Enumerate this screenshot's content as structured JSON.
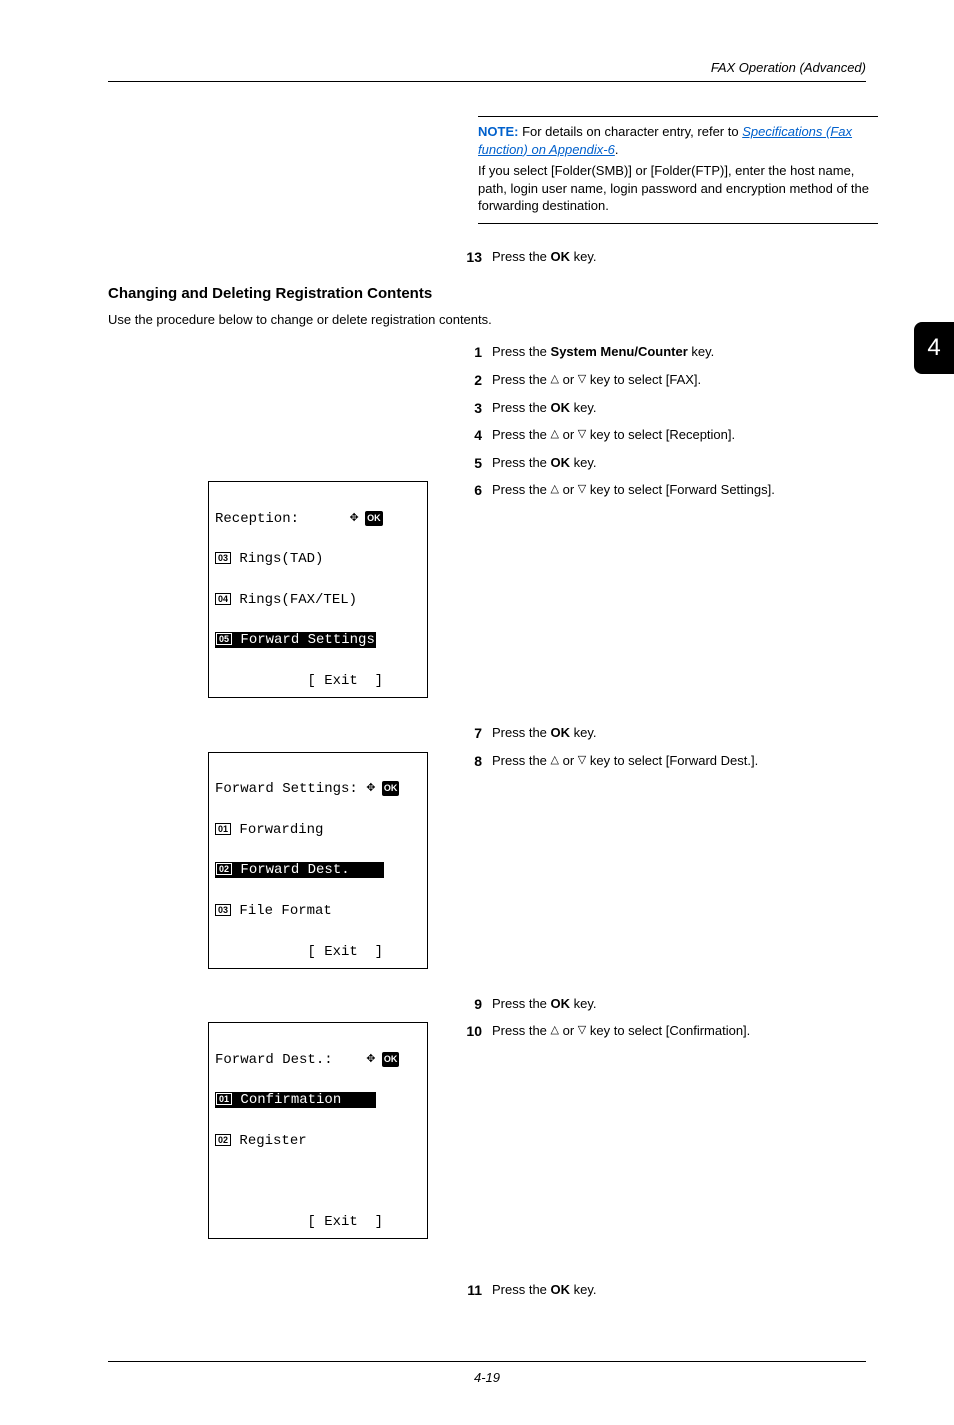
{
  "header": {
    "running": "FAX Operation (Advanced)"
  },
  "tab": {
    "number": "4"
  },
  "note": {
    "label": "NOTE:",
    "text1": " For details on character entry, refer to ",
    "link": "Specifications (Fax function) on Appendix-6",
    "period": ".",
    "text2": "If you select [Folder(SMB)] or [Folder(FTP)], enter the host name, path, login user name, login password and encryption method of the forwarding destination."
  },
  "step13": {
    "num": "13",
    "pre": "Press the ",
    "key": "OK",
    "post": " key."
  },
  "section": {
    "heading": "Changing and Deleting Registration Contents",
    "intro": "Use the procedure below to change or delete registration contents."
  },
  "steps": {
    "s1": {
      "num": "1",
      "pre": "Press the ",
      "key": "System Menu/Counter",
      "post": " key."
    },
    "s2": {
      "num": "2",
      "pre": "Press the ",
      "mid": " or ",
      "post": " key to select [FAX]."
    },
    "s3": {
      "num": "3",
      "pre": "Press the ",
      "key": "OK",
      "post": " key."
    },
    "s4": {
      "num": "4",
      "pre": "Press the ",
      "mid": " or ",
      "post": " key to select [Reception]."
    },
    "s5": {
      "num": "5",
      "pre": "Press the ",
      "key": "OK",
      "post": " key."
    },
    "s6": {
      "num": "6",
      "pre": "Press the ",
      "mid": " or ",
      "post": " key to select [Forward Settings]."
    },
    "s7": {
      "num": "7",
      "pre": "Press the ",
      "key": "OK",
      "post": " key."
    },
    "s8": {
      "num": "8",
      "pre": "Press the ",
      "mid": " or ",
      "post": " key to select [Forward Dest.]."
    },
    "s9": {
      "num": "9",
      "pre": "Press the ",
      "key": "OK",
      "post": " key."
    },
    "s10": {
      "num": "10",
      "pre": "Press the ",
      "mid": " or ",
      "post": " key to select [Confirmation]."
    },
    "s11": {
      "num": "11",
      "pre": "Press the ",
      "key": "OK",
      "post": " key."
    }
  },
  "lcd1": {
    "title": "Reception:",
    "r1num": "03",
    "r1": " Rings(TAD)",
    "r2num": "04",
    "r2": " Rings(FAX/TEL)",
    "r3num": "05",
    "r3": " Forward Settings",
    "exit": "[ Exit  ]"
  },
  "lcd2": {
    "title": "Forward Settings:",
    "r1num": "01",
    "r1": " Forwarding",
    "r2num": "02",
    "r2": " Forward Dest.",
    "r3num": "03",
    "r3": " File Format",
    "exit": "[ Exit  ]"
  },
  "lcd3": {
    "title": "Forward Dest.:",
    "r1num": "01",
    "r1": " Confirmation",
    "r2num": "02",
    "r2": " Register",
    "exit": "[ Exit  ]"
  },
  "footer": {
    "pagenum": "4-19"
  },
  "glyph": {
    "up": "△",
    "down": "▽",
    "ok": "OK",
    "nav": "✥"
  }
}
